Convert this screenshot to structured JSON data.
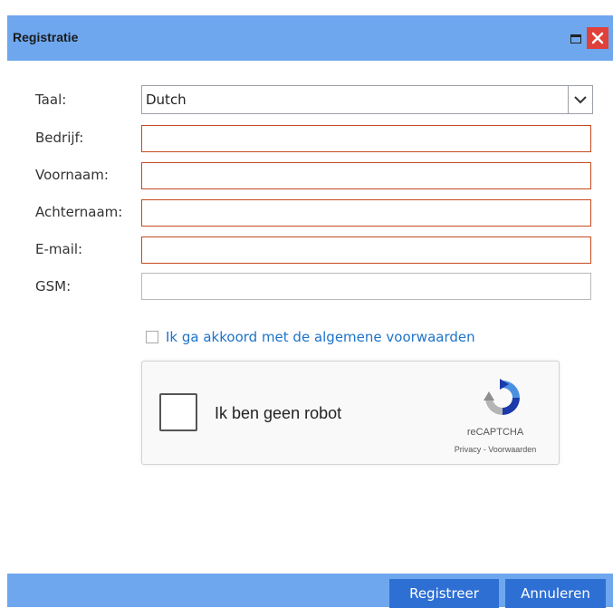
{
  "dialog": {
    "title": "Registratie"
  },
  "form": {
    "language": {
      "label": "Taal:",
      "value": "Dutch"
    },
    "company": {
      "label": "Bedrijf:",
      "value": ""
    },
    "firstname": {
      "label": "Voornaam:",
      "value": ""
    },
    "lastname": {
      "label": "Achternaam:",
      "value": ""
    },
    "email": {
      "label": "E-mail:",
      "value": ""
    },
    "mobile": {
      "label": "GSM:",
      "value": ""
    },
    "agree_label": "Ik ga akkoord met de algemene voorwaarden"
  },
  "recaptcha": {
    "checkbox_label": "Ik ben geen robot",
    "brand": "reCAPTCHA",
    "links": "Privacy - Voorwaarden"
  },
  "footer": {
    "register_label": "Registreer",
    "cancel_label": "Annuleren"
  },
  "colors": {
    "titlebar": "#6ea7ee",
    "button": "#2e6fd4",
    "invalid_border": "#c64a1e",
    "link": "#1e73c8",
    "close": "#e0403a"
  }
}
